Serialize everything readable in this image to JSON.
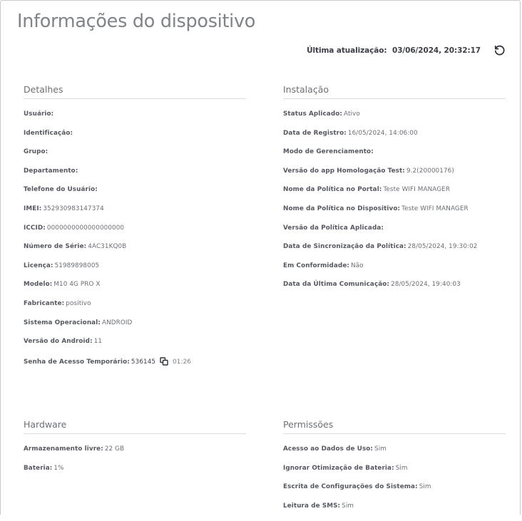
{
  "page": {
    "title": "Informações do dispositivo",
    "last_update_label": "Última atualização:",
    "last_update_value": "03/06/2024, 20:32:17",
    "refresh_icon": "refresh-icon"
  },
  "detalhes": {
    "title": "Detalhes",
    "rows": [
      {
        "label": "Usuário:",
        "value": ""
      },
      {
        "label": "Identificação:",
        "value": ""
      },
      {
        "label": "Grupo:",
        "value": ""
      },
      {
        "label": "Departamento:",
        "value": ""
      },
      {
        "label": "Telefone do Usuário:",
        "value": ""
      },
      {
        "label": "IMEI:",
        "value": "352930983147374"
      },
      {
        "label": "ICCID:",
        "value": "0000000000000000000"
      },
      {
        "label": "Número de Série:",
        "value": "4AC31KQ0B"
      },
      {
        "label": "Licença:",
        "value": "51989898005"
      },
      {
        "label": "Modelo:",
        "value": "M10 4G PRO X"
      },
      {
        "label": "Fabricante:",
        "value": "positivo"
      },
      {
        "label": "Sistema Operacional:",
        "value": "ANDROID"
      },
      {
        "label": "Versão do Android:",
        "value": "11"
      },
      {
        "label": "Senha de Acesso Temporário:",
        "value": "536145",
        "timer": "01:26",
        "copy_icon": "copy-icon"
      }
    ]
  },
  "instalacao": {
    "title": "Instalação",
    "rows": [
      {
        "label": "Status Aplicado:",
        "value": "Ativo"
      },
      {
        "label": "Data de Registro:",
        "value": "16/05/2024, 14:06:00"
      },
      {
        "label": "Modo de Gerenciamento:",
        "value": ""
      },
      {
        "label": "Versão do app Homologação Test:",
        "value": "9.2(20000176)"
      },
      {
        "label": "Nome da Política no Portal:",
        "value": "Teste WIFI MANAGER"
      },
      {
        "label": "Nome da Política no Dispositivo:",
        "value": "Teste WIFI MANAGER"
      },
      {
        "label": "Versão da Política Aplicada:",
        "value": ""
      },
      {
        "label": "Data de Sincronização da Política:",
        "value": "28/05/2024, 19:30:02"
      },
      {
        "label": "Em Conformidade:",
        "value": "Não"
      },
      {
        "label": "Data da Última Comunicação:",
        "value": "28/05/2024, 19:40:03"
      }
    ]
  },
  "hardware": {
    "title": "Hardware",
    "rows": [
      {
        "label": "Armazenamento livre:",
        "value": "22 GB"
      },
      {
        "label": "Bateria:",
        "value": "1%"
      }
    ]
  },
  "permissoes": {
    "title": "Permissões",
    "rows": [
      {
        "label": "Acesso ao Dados de Uso:",
        "value": "Sim"
      },
      {
        "label": "Ignorar Otimização de Bateria:",
        "value": "Sim"
      },
      {
        "label": "Escrita de Configurações do Sistema:",
        "value": "Sim"
      },
      {
        "label": "Leitura de SMS:",
        "value": "Sim"
      }
    ]
  }
}
